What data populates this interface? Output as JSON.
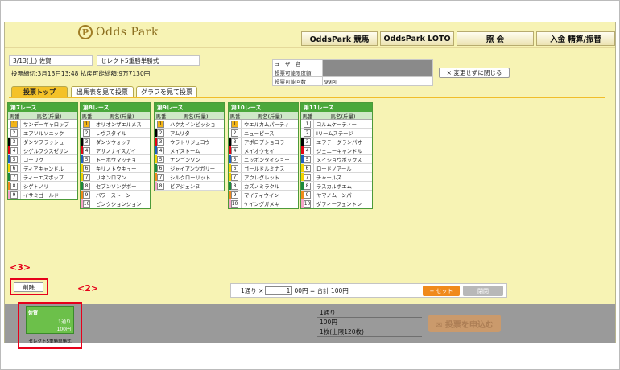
{
  "header": {
    "logo_text": "Odds Park",
    "logo_mark": "P",
    "nav": [
      "OddsPark 競馬",
      "OddsPark LOTO",
      "照 会",
      "入金 精算/振替"
    ]
  },
  "race_info": {
    "date_place": "3/13(土) 佐賀",
    "bet_type": "セレクト5重勝単勝式",
    "deadline_line": "投票締切:3月13日13:48  払戻可能総額:9万7130円"
  },
  "account": {
    "rows": [
      {
        "label": "ユーザー名",
        "value": ""
      },
      {
        "label": "投票可能限度額",
        "value": ""
      },
      {
        "label": "投票可能回数",
        "value": "99回"
      }
    ],
    "close_button": "× 変更せずに閉じる"
  },
  "tabs": [
    "投票トップ",
    "出馬表を見て投票",
    "グラフを見て投票"
  ],
  "columns": {
    "num": "馬番",
    "name": "馬名(斤量)"
  },
  "races": [
    {
      "title": "第7レース",
      "horses": [
        "サンデーギャロップ",
        "エアソルソニック",
        "ダンツフラッシュ",
        "シゲルフクスゼサン",
        "コーリク",
        "ディアキャンドル",
        "ティーエスポップ",
        "シゲトノリ",
        "イサミゴールド"
      ],
      "selected": 1
    },
    {
      "title": "第8レース",
      "horses": [
        "オリオンザエルメス",
        "レヴスタイル",
        "ダンツウォッチ",
        "アサノナイスガイ",
        "トーホウマッチョ",
        "キリノトウキュー",
        "リネンロマン",
        "セブンソングボー",
        "バワーストーン",
        "ビンクションション"
      ],
      "selected": 1
    },
    {
      "title": "第9レース",
      "horses": [
        "ハクカインビッショ",
        "アムリタ",
        "ウラトリジュコウ",
        "メイストーム",
        "ナンゴンゾン",
        "ジャイアンツガリー",
        "シルクローリット",
        "ビアジェンヌ"
      ],
      "selected": 1
    },
    {
      "title": "第10レース",
      "horses": [
        "ウエルカムパーティ",
        "ニューピース",
        "アポロプショコラ",
        "メイオウセイ",
        "ニッポンタイショー",
        "ゴールドルミナス",
        "アウレグレット",
        "カズノミラクル",
        "マイティウイン",
        "ケイングガメキ"
      ],
      "selected": 1
    },
    {
      "title": "第11レース",
      "horses": [
        "コルムケーティー",
        "Iリームステージ",
        "エフテーグランパオ",
        "ジェニーキャンドル",
        "メイショウボックス",
        "ロードノアール",
        "チャールズ",
        "ラスカルボエム",
        "ヤマノムーンパー",
        "ダフィーフェントン"
      ],
      "selected": 0
    }
  ],
  "annotations": {
    "label3": "<3>",
    "label2": "<2>"
  },
  "controls": {
    "delete": "削除",
    "prefix": "1通り ×",
    "quantity": "1",
    "suffix": "00円 = 合計 100円",
    "set": "+ セット",
    "clear": "閉閉"
  },
  "ticket": {
    "place": "佐賀",
    "combos": "1通り",
    "amount": "100円",
    "caption": "セレクト5重勝単勝式"
  },
  "summary": [
    "1通り",
    "100円",
    "1枚(上限120枚)"
  ],
  "apply_button": "✉ 投票を申込む",
  "colors": {
    "frame_1": "#ffffff",
    "frame_2": "#000000",
    "frame_3": "#e60012",
    "frame_4": "#1f5ebf",
    "frame_5": "#f4d300",
    "frame_6": "#1c8a3c",
    "frame_7": "#f08a1c",
    "frame_8": "#f5a3c8",
    "accent_red": "#e6001a",
    "tab_active": "#f4c228",
    "race_header": "#4aa83b"
  }
}
